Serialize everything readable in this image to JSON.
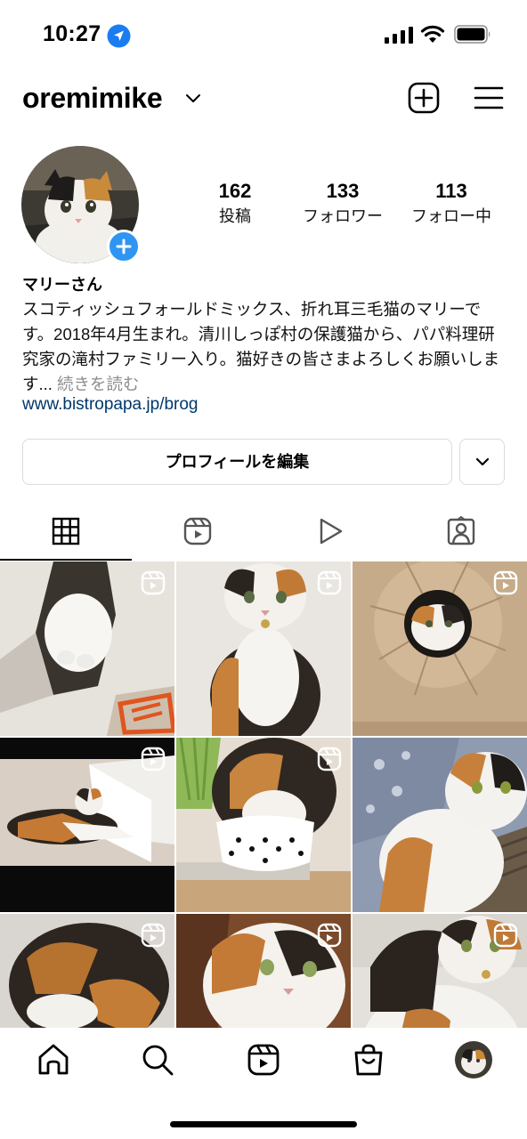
{
  "status_bar": {
    "time": "10:27",
    "icons": [
      "location-arrow-icon",
      "signal-icon",
      "wifi-icon",
      "battery-icon"
    ]
  },
  "header": {
    "username": "oremimike",
    "icons": [
      "chevron-down-icon",
      "new-post-icon",
      "menu-icon"
    ]
  },
  "profile": {
    "stats": {
      "posts": {
        "value": "162",
        "label": "投稿"
      },
      "followers": {
        "value": "133",
        "label": "フォロワー"
      },
      "following": {
        "value": "113",
        "label": "フォロー中"
      }
    },
    "display_name": "マリーさん",
    "bio": "スコティッシュフォールドミックス、折れ耳三毛猫のマリーです。2018年4月生まれ。清川しっぽ村の保護猫から、パパ料理研究家の滝村ファミリー入り。猫好きの皆さまよろしくお願いします...",
    "bio_more": " 続きを読む",
    "link": "www.bistropapa.jp/brog"
  },
  "actions": {
    "edit_profile": "プロフィールを編集"
  },
  "tabs": [
    {
      "icon": "grid-icon",
      "active": true
    },
    {
      "icon": "reels-icon",
      "active": false
    },
    {
      "icon": "play-icon",
      "active": false
    },
    {
      "icon": "tagged-icon",
      "active": false
    }
  ],
  "grid": {
    "posts_visible": 9,
    "reel_badge_icon": "reel-icon"
  },
  "bottom_nav": [
    "home-icon",
    "search-icon",
    "reels-icon",
    "shop-icon",
    "profile-avatar"
  ],
  "colors": {
    "accent_blue": "#2f95f3",
    "link_blue": "#00376b",
    "border": "#dbdbdb",
    "muted": "#8e8e8e"
  }
}
